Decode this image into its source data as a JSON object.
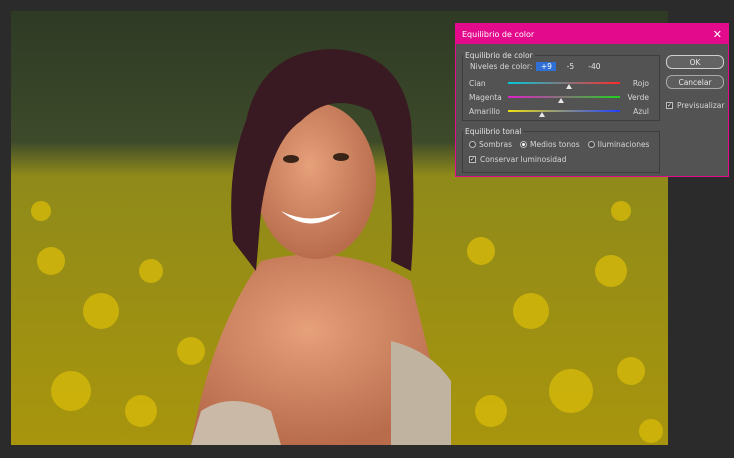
{
  "dialog": {
    "title": "Equilibrio de color",
    "color_balance_group": "Equilibrio de color",
    "levels_label": "Niveles de color:",
    "levels": [
      "+9",
      "-5",
      "-40"
    ],
    "sliders": [
      {
        "left": "Cian",
        "right": "Rojo",
        "value": 9
      },
      {
        "left": "Magenta",
        "right": "Verde",
        "value": -5
      },
      {
        "left": "Amarillo",
        "right": "Azul",
        "value": -40
      }
    ],
    "tone_group": "Equilibrio tonal",
    "tones": {
      "shadows": "Sombras",
      "midtones": "Medios tonos",
      "highlights": "Iluminaciones",
      "selected": "Medios tonos"
    },
    "preserve_luminosity": "Conservar luminosidad",
    "ok": "OK",
    "cancel": "Cancelar",
    "preview": "Previsualizar"
  },
  "colors": {
    "accent": "#e40a8c",
    "dialog_bg": "#535353",
    "app_bg": "#2b2b2b"
  }
}
